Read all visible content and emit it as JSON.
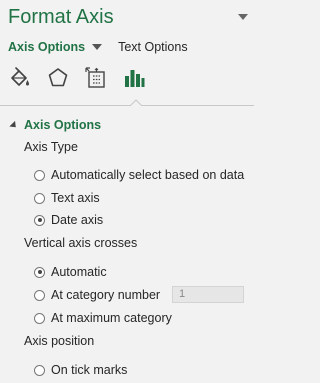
{
  "pane": {
    "title": "Format Axis"
  },
  "tabs": {
    "main_label": "Axis Options",
    "secondary_label": "Text Options"
  },
  "icons": [
    {
      "name": "fill-line-icon",
      "selected": false
    },
    {
      "name": "effects-pentagon-icon",
      "selected": false
    },
    {
      "name": "size-properties-icon",
      "selected": false
    },
    {
      "name": "axis-options-chart-icon",
      "selected": true
    }
  ],
  "section": {
    "label": "Axis Options"
  },
  "axis_type": {
    "label": "Axis Type",
    "options": [
      {
        "label": "Automatically select based on data",
        "checked": false
      },
      {
        "label": "Text axis",
        "checked": false
      },
      {
        "label": "Date axis",
        "checked": true
      }
    ]
  },
  "vertical_axis_crosses": {
    "label": "Vertical axis crosses",
    "options": [
      {
        "label": "Automatic",
        "checked": true
      },
      {
        "label": "At category number",
        "checked": false
      },
      {
        "label": "At maximum category",
        "checked": false
      }
    ],
    "category_number_value": "1"
  },
  "axis_position": {
    "label": "Axis position",
    "options": [
      {
        "label": "On tick marks",
        "checked": false
      }
    ]
  },
  "colors": {
    "accent": "#217346",
    "background": "#f2f2f2"
  }
}
